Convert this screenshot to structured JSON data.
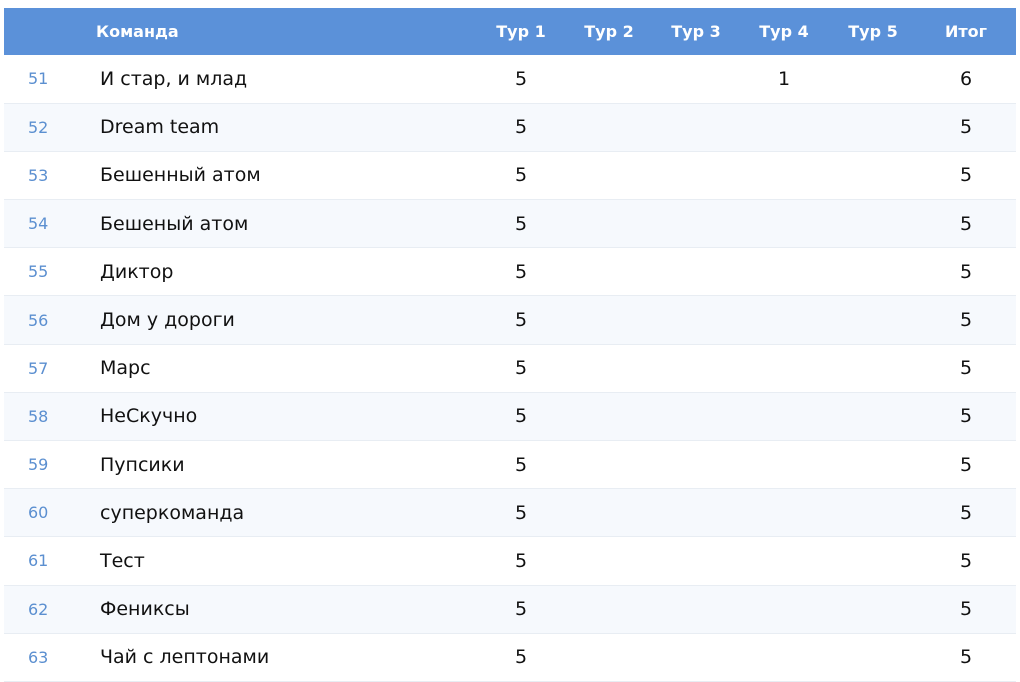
{
  "header": {
    "num": "",
    "team": "Команда",
    "tour1": "Тур 1",
    "tour2": "Тур 2",
    "tour3": "Тур 3",
    "tour4": "Тур 4",
    "tour5": "Тур 5",
    "total": "Итог"
  },
  "rows": [
    {
      "num": "51",
      "team": "И стар, и млад",
      "t1": "5",
      "t2": "",
      "t3": "",
      "t4": "1",
      "t5": "",
      "total": "6"
    },
    {
      "num": "52",
      "team": "Dream team",
      "t1": "5",
      "t2": "",
      "t3": "",
      "t4": "",
      "t5": "",
      "total": "5"
    },
    {
      "num": "53",
      "team": "Бешенный атом",
      "t1": "5",
      "t2": "",
      "t3": "",
      "t4": "",
      "t5": "",
      "total": "5"
    },
    {
      "num": "54",
      "team": "Бешеный атом",
      "t1": "5",
      "t2": "",
      "t3": "",
      "t4": "",
      "t5": "",
      "total": "5"
    },
    {
      "num": "55",
      "team": "Диктор",
      "t1": "5",
      "t2": "",
      "t3": "",
      "t4": "",
      "t5": "",
      "total": "5"
    },
    {
      "num": "56",
      "team": "Дом у дороги",
      "t1": "5",
      "t2": "",
      "t3": "",
      "t4": "",
      "t5": "",
      "total": "5"
    },
    {
      "num": "57",
      "team": "Марс",
      "t1": "5",
      "t2": "",
      "t3": "",
      "t4": "",
      "t5": "",
      "total": "5"
    },
    {
      "num": "58",
      "team": "НеСкучно",
      "t1": "5",
      "t2": "",
      "t3": "",
      "t4": "",
      "t5": "",
      "total": "5"
    },
    {
      "num": "59",
      "team": "Пупсики",
      "t1": "5",
      "t2": "",
      "t3": "",
      "t4": "",
      "t5": "",
      "total": "5"
    },
    {
      "num": "60",
      "team": "суперкоманда",
      "t1": "5",
      "t2": "",
      "t3": "",
      "t4": "",
      "t5": "",
      "total": "5"
    },
    {
      "num": "61",
      "team": "Тест",
      "t1": "5",
      "t2": "",
      "t3": "",
      "t4": "",
      "t5": "",
      "total": "5"
    },
    {
      "num": "62",
      "team": "Фениксы",
      "t1": "5",
      "t2": "",
      "t3": "",
      "t4": "",
      "t5": "",
      "total": "5"
    },
    {
      "num": "63",
      "team": "Чай с лептонами",
      "t1": "5",
      "t2": "",
      "t3": "",
      "t4": "",
      "t5": "",
      "total": "5"
    }
  ]
}
